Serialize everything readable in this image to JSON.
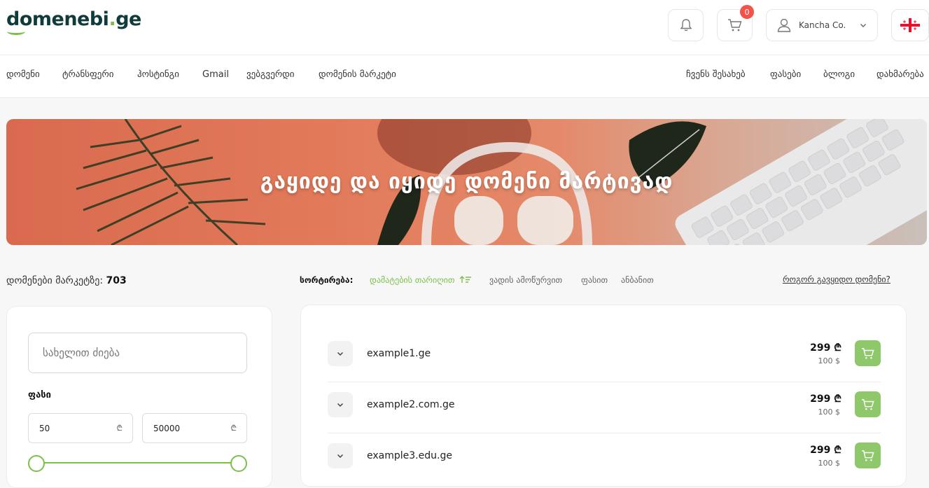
{
  "brand": {
    "name_main": "domenebi",
    "name_dot": ".",
    "name_tld": "ge",
    "accent": "#7cc04b"
  },
  "header": {
    "cart_count": "0",
    "user_name": "Kancha Co.",
    "language_flag": "georgia-flag-icon"
  },
  "nav": {
    "left": [
      "დომენი",
      "ტრანსფერი",
      "ჰოსტინგი",
      "Gmail",
      "ვებგვერდი",
      "დომენის მარკეტი"
    ],
    "right": [
      "ჩვენს შესახებ",
      "ფასები",
      "ბლოგი",
      "დახმარება"
    ]
  },
  "banner": {
    "title": "გაყიდე და იყიდე დომენი მარტივად"
  },
  "stats": {
    "count_label": "დომენები მარკეტზე:",
    "count_value": "703"
  },
  "sort": {
    "label": "სორტირება:",
    "options": [
      "დამატების თარიღით",
      "ვადის ამოწურვით",
      "ფასით",
      "ანბანით"
    ],
    "active_index": 0
  },
  "howto_link": "როგორ გავყიდო დომენი?",
  "filter": {
    "search_placeholder": "სახელით ძიება",
    "price_label": "ფასი",
    "price_min": "50",
    "price_max": "50000",
    "currency_symbol": "₾",
    "range_min": 0,
    "range_max": 1
  },
  "domains": [
    {
      "name": "example1.ge",
      "price_gel": "299 ₾",
      "price_usd": "100 $"
    },
    {
      "name": "example2.com.ge",
      "price_gel": "299 ₾",
      "price_usd": "100 $"
    },
    {
      "name": "example3.edu.ge",
      "price_gel": "299 ₾",
      "price_usd": "100 $"
    }
  ]
}
